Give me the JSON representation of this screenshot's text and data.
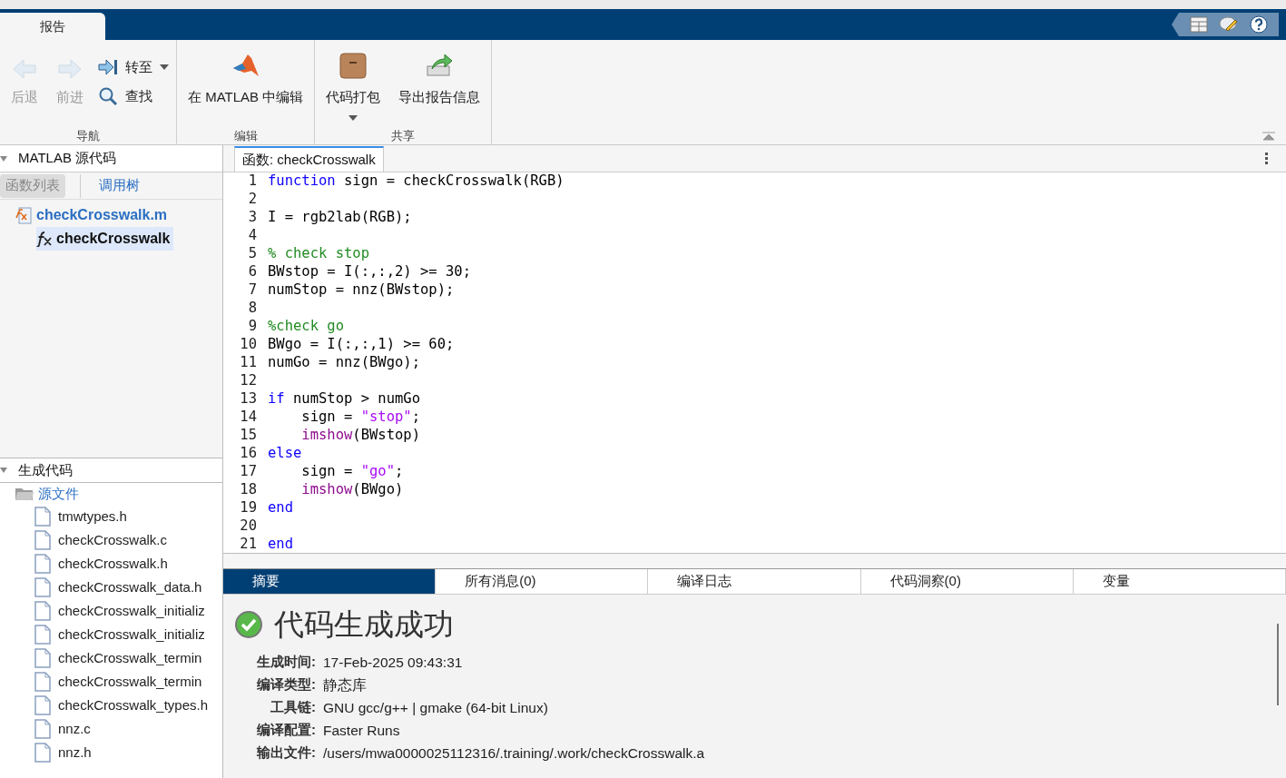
{
  "ribbon_tabs": [
    {
      "label": "报告",
      "selected": true
    }
  ],
  "toolstrip": {
    "groups": [
      {
        "label": "导航",
        "items": [
          {
            "kind": "nav-back",
            "label": "后退",
            "disabled": true
          },
          {
            "kind": "nav-forward",
            "label": "前进",
            "disabled": true
          },
          {
            "kind": "goto",
            "label": "转至"
          },
          {
            "kind": "find",
            "label": "查找"
          }
        ]
      },
      {
        "label": "编辑",
        "items": [
          {
            "kind": "matlab",
            "label": "在 MATLAB 中编辑"
          }
        ]
      },
      {
        "label": "共享",
        "items": [
          {
            "kind": "package",
            "label": "代码打包"
          },
          {
            "kind": "export",
            "label": "导出报告信息"
          }
        ]
      }
    ]
  },
  "source_panel": {
    "title": "MATLAB 源代码",
    "tabs": [
      {
        "label": "函数列表",
        "selected": true
      },
      {
        "label": "调用树",
        "selected": false
      }
    ],
    "tree": [
      {
        "label": "checkCrosswalk.m",
        "kind": "mfile",
        "selected": false,
        "children": [
          {
            "label": "checkCrosswalk",
            "kind": "function",
            "selected": true
          }
        ]
      }
    ]
  },
  "generated_panel": {
    "title": "生成代码",
    "tree": [
      {
        "label": "源文件",
        "kind": "folder",
        "children": [
          {
            "label": "tmwtypes.h"
          },
          {
            "label": "checkCrosswalk.c"
          },
          {
            "label": "checkCrosswalk.h"
          },
          {
            "label": "checkCrosswalk_data.h"
          },
          {
            "label": "checkCrosswalk_initializ"
          },
          {
            "label": "checkCrosswalk_initializ"
          },
          {
            "label": "checkCrosswalk_termin"
          },
          {
            "label": "checkCrosswalk_termin"
          },
          {
            "label": "checkCrosswalk_types.h"
          },
          {
            "label": "nnz.c"
          },
          {
            "label": "nnz.h"
          }
        ]
      }
    ]
  },
  "editor": {
    "tabs": [
      {
        "label": "函数: checkCrosswalk",
        "selected": true
      }
    ],
    "lines": [
      {
        "number": "1",
        "tokens": [
          {
            "text": "function",
            "kind": "keyword"
          },
          {
            "text": " sign = checkCrosswalk(RGB)",
            "kind": "plain"
          }
        ]
      },
      {
        "number": "2"
      },
      {
        "number": "3",
        "tokens": [
          {
            "text": "I = rgb2lab(RGB);",
            "kind": "plain"
          }
        ]
      },
      {
        "number": "4"
      },
      {
        "number": "5",
        "tokens": [
          {
            "text": "% check stop",
            "kind": "comment"
          }
        ]
      },
      {
        "number": "6",
        "tokens": [
          {
            "text": "BWstop = I(:,:,2) >= 30;",
            "kind": "plain"
          }
        ]
      },
      {
        "number": "7",
        "tokens": [
          {
            "text": "numStop = nnz(BWstop);",
            "kind": "plain"
          }
        ]
      },
      {
        "number": "8"
      },
      {
        "number": "9",
        "tokens": [
          {
            "text": "%check go",
            "kind": "comment"
          }
        ]
      },
      {
        "number": "10",
        "tokens": [
          {
            "text": "BWgo = I(:,:,1) >= 60;",
            "kind": "plain"
          }
        ]
      },
      {
        "number": "11",
        "tokens": [
          {
            "text": "numGo = nnz(BWgo);",
            "kind": "plain"
          }
        ]
      },
      {
        "number": "12"
      },
      {
        "number": "13",
        "tokens": [
          {
            "text": "if",
            "kind": "keyword"
          },
          {
            "text": " numStop > numGo",
            "kind": "plain"
          }
        ]
      },
      {
        "number": "14",
        "tokens": [
          {
            "text": "    sign = ",
            "kind": "plain"
          },
          {
            "text": "\"stop\"",
            "kind": "string"
          },
          {
            "text": ";",
            "kind": "plain"
          }
        ]
      },
      {
        "number": "15",
        "tokens": [
          {
            "text": "    imshow",
            "kind": "function"
          },
          {
            "text": "(BWstop)",
            "kind": "plain"
          }
        ]
      },
      {
        "number": "16",
        "tokens": [
          {
            "text": "else",
            "kind": "keyword"
          }
        ]
      },
      {
        "number": "17",
        "tokens": [
          {
            "text": "    sign = ",
            "kind": "plain"
          },
          {
            "text": "\"go\"",
            "kind": "string"
          },
          {
            "text": ";",
            "kind": "plain"
          }
        ]
      },
      {
        "number": "18",
        "tokens": [
          {
            "text": "    imshow",
            "kind": "function"
          },
          {
            "text": "(BWgo)",
            "kind": "plain"
          }
        ]
      },
      {
        "number": "19",
        "tokens": [
          {
            "text": "end",
            "kind": "keyword"
          }
        ]
      },
      {
        "number": "20"
      },
      {
        "number": "21",
        "tokens": [
          {
            "text": "end",
            "kind": "keyword"
          }
        ]
      }
    ]
  },
  "report": {
    "tabs": [
      {
        "label": "摘要",
        "selected": true
      },
      {
        "label": "所有消息(0)",
        "selected": false
      },
      {
        "label": "编译日志",
        "selected": false
      },
      {
        "label": "代码洞察(0)",
        "selected": false
      },
      {
        "label": "变量",
        "selected": false
      }
    ],
    "status": {
      "kind": "success",
      "title": "代码生成成功"
    },
    "fields": [
      {
        "label": "生成时间:",
        "value": "17-Feb-2025 09:43:31"
      },
      {
        "label": "编译类型:",
        "value": "静态库"
      },
      {
        "label": "工具链:",
        "value": "GNU gcc/g++ | gmake (64-bit Linux)"
      },
      {
        "label": "编译配置:",
        "value": "Faster Runs"
      },
      {
        "label": "输出文件:",
        "value": "/users/mwa0000025112316/.training/.work/checkCrosswalk.a"
      }
    ]
  }
}
